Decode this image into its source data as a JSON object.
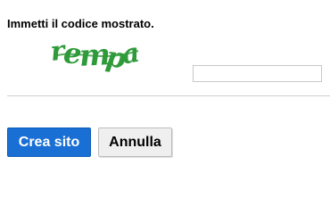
{
  "form": {
    "prompt": "Immetti il codice mostrato.",
    "captcha": {
      "text": "rempa",
      "color": "#2f9a3a"
    },
    "code_input": {
      "value": "",
      "placeholder": ""
    }
  },
  "actions": {
    "submit_label": "Crea sito",
    "cancel_label": "Annulla"
  },
  "colors": {
    "primary_button": "#1a6fd4",
    "secondary_button": "#efefef",
    "divider": "#cfcfcf"
  }
}
